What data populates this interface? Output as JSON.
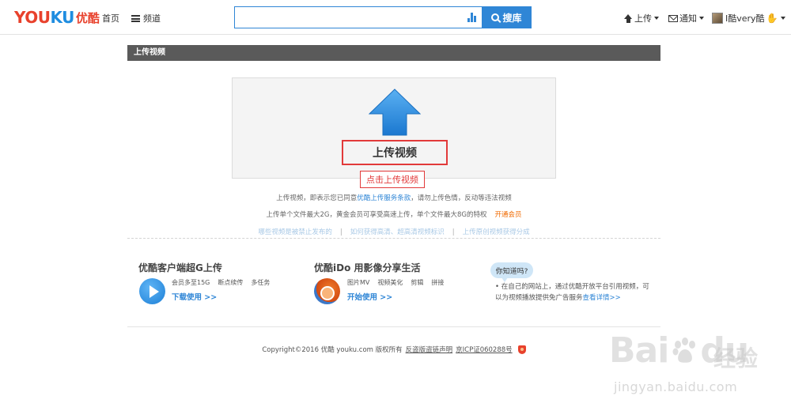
{
  "header": {
    "logo_en_a": "YOU",
    "logo_en_b": "KU",
    "logo_cn": "优酷",
    "nav_home": "首页",
    "nav_channel": "频道",
    "search_placeholder": "",
    "search_button": "搜库",
    "upload": "上传",
    "notify": "通知",
    "user": "I酷very酷"
  },
  "title_bar": "上传视频",
  "upload": {
    "label": "上传视频",
    "click_note": "点击上传视频"
  },
  "notes": {
    "line1_pre": "上传视频，即表示您已同意",
    "line1_link": "优酷上传服务条款",
    "line1_post": "，请勿上传色情，反动等违法视频",
    "line2": "上传单个文件最大2G，黄金会员可享受高速上传，单个文件最大8G的特权",
    "line2_link": "开通会员",
    "faint_links": [
      "哪些视频是被禁止发布的",
      "如何获得高清、超高清视频标识",
      "上传原创视频获得分成"
    ]
  },
  "features": {
    "client": {
      "title": "优酷客户端超G上传",
      "tags": [
        "会员多至15G",
        "断点续传",
        "多任务"
      ],
      "link": "下载使用 >>"
    },
    "ido": {
      "title": "优酷iDo 用影像分享生活",
      "tags": [
        "图片MV",
        "视频美化",
        "剪辑",
        "拼接"
      ],
      "link": "开始使用 >>"
    },
    "tip_bubble": "你知道吗?",
    "tip_text": "• 在自己的网站上，通过优酷开放平台引用视频，可以为视频播放提供免广告服务",
    "tip_link": "查看详情>>"
  },
  "footer": {
    "copyright": "Copyright©2016 优酷 youku.com 版权所有",
    "link1": "反盗版盗链声明",
    "link2": "京ICP证060288号"
  },
  "watermark": {
    "big": "Bai",
    "big2": "du",
    "cn": "经验",
    "url": "jingyan.baidu.com"
  },
  "colors": {
    "accent": "#2f86d6",
    "logo_red": "#e8412c",
    "highlight_red": "#e23a3a",
    "orange": "#f06a00"
  }
}
